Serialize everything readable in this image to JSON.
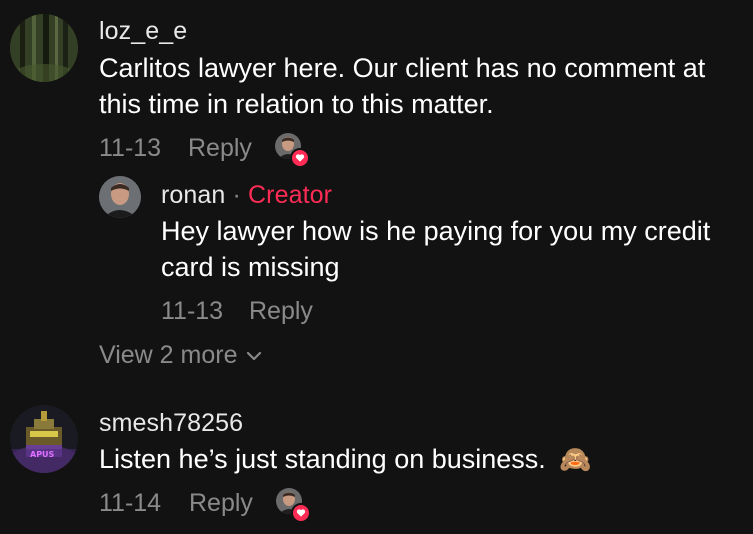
{
  "comments": [
    {
      "username": "loz_e_e",
      "text_line1": "Carlitos lawyer here. Our client has no comment at",
      "text_line2": "this time in relation to this matter.",
      "date": "11-13",
      "reply_label": "Reply",
      "avatar": "forest-avatar",
      "liked_by_creator": true,
      "replies": [
        {
          "username": "ronan",
          "separator": "·",
          "badge": "Creator",
          "text_line1": "Hey lawyer how is he paying for you my credit",
          "text_line2": "card is missing",
          "date": "11-13",
          "reply_label": "Reply",
          "avatar": "man-avatar"
        }
      ],
      "view_more_label": "View 2 more"
    },
    {
      "username": "smesh78256",
      "text": "Listen he’s just standing on business.",
      "emoji": "🙈",
      "date": "11-14",
      "reply_label": "Reply",
      "avatar": "building-lights-avatar",
      "avatar_text": "APUS",
      "liked_by_creator": true
    }
  ],
  "colors": {
    "background": "#121212",
    "creator_badge": "#fe2c55",
    "muted_text": "#8a8a8a",
    "heart_badge": "#fe2c55"
  },
  "icons": {
    "view_more": "chevron-down-icon",
    "liked": "heart-icon"
  }
}
